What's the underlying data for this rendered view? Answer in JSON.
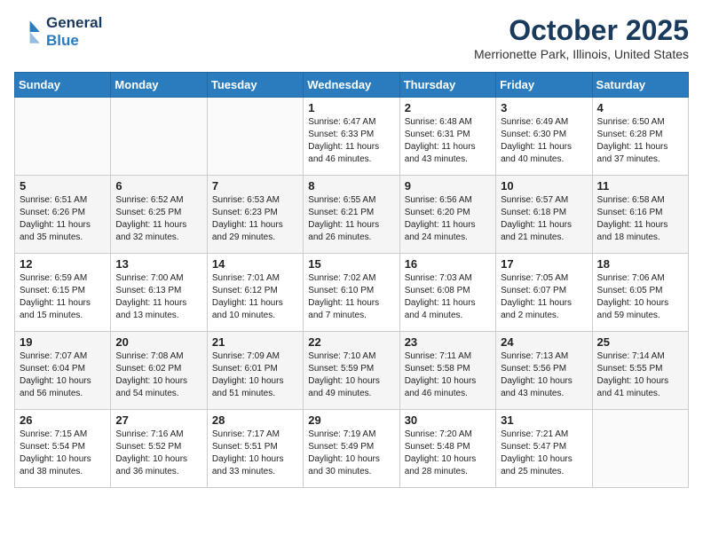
{
  "header": {
    "logo_line1": "General",
    "logo_line2": "Blue",
    "month": "October 2025",
    "location": "Merrionette Park, Illinois, United States"
  },
  "weekdays": [
    "Sunday",
    "Monday",
    "Tuesday",
    "Wednesday",
    "Thursday",
    "Friday",
    "Saturday"
  ],
  "weeks": [
    [
      {
        "day": "",
        "info": ""
      },
      {
        "day": "",
        "info": ""
      },
      {
        "day": "",
        "info": ""
      },
      {
        "day": "1",
        "info": "Sunrise: 6:47 AM\nSunset: 6:33 PM\nDaylight: 11 hours and 46 minutes."
      },
      {
        "day": "2",
        "info": "Sunrise: 6:48 AM\nSunset: 6:31 PM\nDaylight: 11 hours and 43 minutes."
      },
      {
        "day": "3",
        "info": "Sunrise: 6:49 AM\nSunset: 6:30 PM\nDaylight: 11 hours and 40 minutes."
      },
      {
        "day": "4",
        "info": "Sunrise: 6:50 AM\nSunset: 6:28 PM\nDaylight: 11 hours and 37 minutes."
      }
    ],
    [
      {
        "day": "5",
        "info": "Sunrise: 6:51 AM\nSunset: 6:26 PM\nDaylight: 11 hours and 35 minutes."
      },
      {
        "day": "6",
        "info": "Sunrise: 6:52 AM\nSunset: 6:25 PM\nDaylight: 11 hours and 32 minutes."
      },
      {
        "day": "7",
        "info": "Sunrise: 6:53 AM\nSunset: 6:23 PM\nDaylight: 11 hours and 29 minutes."
      },
      {
        "day": "8",
        "info": "Sunrise: 6:55 AM\nSunset: 6:21 PM\nDaylight: 11 hours and 26 minutes."
      },
      {
        "day": "9",
        "info": "Sunrise: 6:56 AM\nSunset: 6:20 PM\nDaylight: 11 hours and 24 minutes."
      },
      {
        "day": "10",
        "info": "Sunrise: 6:57 AM\nSunset: 6:18 PM\nDaylight: 11 hours and 21 minutes."
      },
      {
        "day": "11",
        "info": "Sunrise: 6:58 AM\nSunset: 6:16 PM\nDaylight: 11 hours and 18 minutes."
      }
    ],
    [
      {
        "day": "12",
        "info": "Sunrise: 6:59 AM\nSunset: 6:15 PM\nDaylight: 11 hours and 15 minutes."
      },
      {
        "day": "13",
        "info": "Sunrise: 7:00 AM\nSunset: 6:13 PM\nDaylight: 11 hours and 13 minutes."
      },
      {
        "day": "14",
        "info": "Sunrise: 7:01 AM\nSunset: 6:12 PM\nDaylight: 11 hours and 10 minutes."
      },
      {
        "day": "15",
        "info": "Sunrise: 7:02 AM\nSunset: 6:10 PM\nDaylight: 11 hours and 7 minutes."
      },
      {
        "day": "16",
        "info": "Sunrise: 7:03 AM\nSunset: 6:08 PM\nDaylight: 11 hours and 4 minutes."
      },
      {
        "day": "17",
        "info": "Sunrise: 7:05 AM\nSunset: 6:07 PM\nDaylight: 11 hours and 2 minutes."
      },
      {
        "day": "18",
        "info": "Sunrise: 7:06 AM\nSunset: 6:05 PM\nDaylight: 10 hours and 59 minutes."
      }
    ],
    [
      {
        "day": "19",
        "info": "Sunrise: 7:07 AM\nSunset: 6:04 PM\nDaylight: 10 hours and 56 minutes."
      },
      {
        "day": "20",
        "info": "Sunrise: 7:08 AM\nSunset: 6:02 PM\nDaylight: 10 hours and 54 minutes."
      },
      {
        "day": "21",
        "info": "Sunrise: 7:09 AM\nSunset: 6:01 PM\nDaylight: 10 hours and 51 minutes."
      },
      {
        "day": "22",
        "info": "Sunrise: 7:10 AM\nSunset: 5:59 PM\nDaylight: 10 hours and 49 minutes."
      },
      {
        "day": "23",
        "info": "Sunrise: 7:11 AM\nSunset: 5:58 PM\nDaylight: 10 hours and 46 minutes."
      },
      {
        "day": "24",
        "info": "Sunrise: 7:13 AM\nSunset: 5:56 PM\nDaylight: 10 hours and 43 minutes."
      },
      {
        "day": "25",
        "info": "Sunrise: 7:14 AM\nSunset: 5:55 PM\nDaylight: 10 hours and 41 minutes."
      }
    ],
    [
      {
        "day": "26",
        "info": "Sunrise: 7:15 AM\nSunset: 5:54 PM\nDaylight: 10 hours and 38 minutes."
      },
      {
        "day": "27",
        "info": "Sunrise: 7:16 AM\nSunset: 5:52 PM\nDaylight: 10 hours and 36 minutes."
      },
      {
        "day": "28",
        "info": "Sunrise: 7:17 AM\nSunset: 5:51 PM\nDaylight: 10 hours and 33 minutes."
      },
      {
        "day": "29",
        "info": "Sunrise: 7:19 AM\nSunset: 5:49 PM\nDaylight: 10 hours and 30 minutes."
      },
      {
        "day": "30",
        "info": "Sunrise: 7:20 AM\nSunset: 5:48 PM\nDaylight: 10 hours and 28 minutes."
      },
      {
        "day": "31",
        "info": "Sunrise: 7:21 AM\nSunset: 5:47 PM\nDaylight: 10 hours and 25 minutes."
      },
      {
        "day": "",
        "info": ""
      }
    ]
  ]
}
